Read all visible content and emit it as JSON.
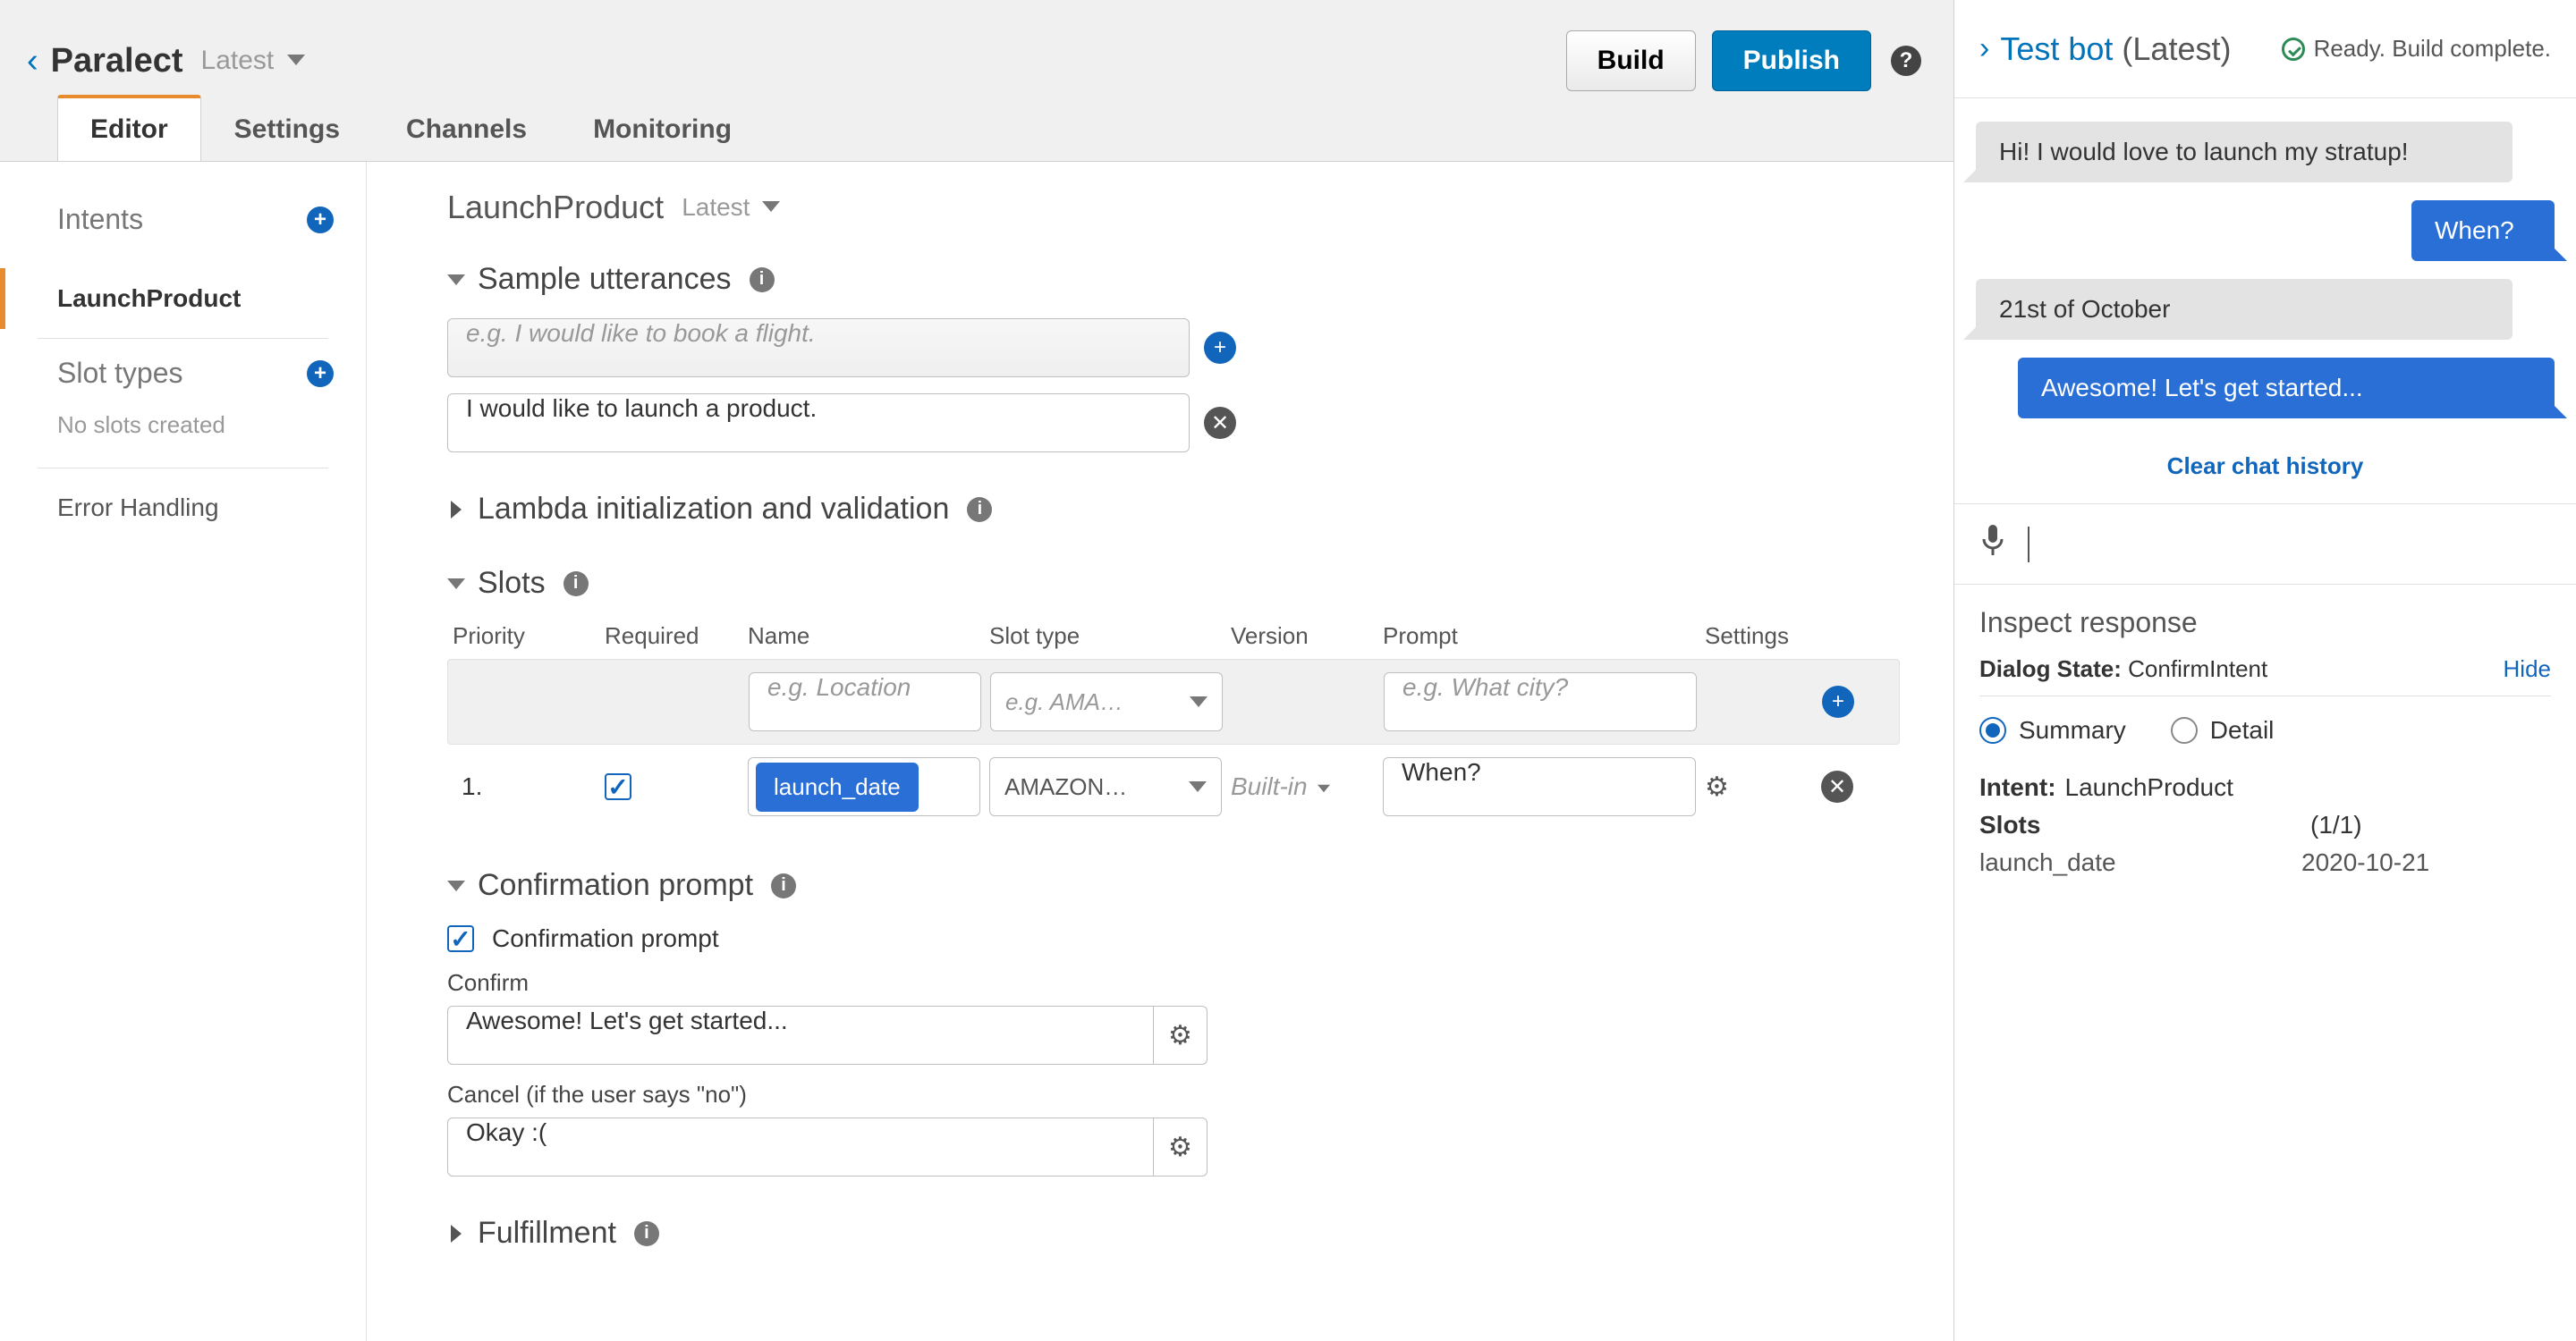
{
  "header": {
    "back_glyph": "‹",
    "title": "Paralect",
    "version": "Latest",
    "build_label": "Build",
    "publish_label": "Publish",
    "help_glyph": "?"
  },
  "tabs": [
    {
      "label": "Editor",
      "active": true
    },
    {
      "label": "Settings",
      "active": false
    },
    {
      "label": "Channels",
      "active": false
    },
    {
      "label": "Monitoring",
      "active": false
    }
  ],
  "sidebar": {
    "intents_label": "Intents",
    "intent_items": [
      "LaunchProduct"
    ],
    "slot_types_label": "Slot types",
    "slot_types_empty": "No slots created",
    "error_handling_label": "Error Handling"
  },
  "intent": {
    "name": "LaunchProduct",
    "version": "Latest"
  },
  "sections": {
    "sample_utterances": "Sample utterances",
    "lambda": "Lambda initialization and validation",
    "slots": "Slots",
    "confirmation": "Confirmation prompt",
    "fulfillment": "Fulfillment"
  },
  "utterances": {
    "placeholder": "e.g. I would like to book a flight.",
    "items": [
      "I would like to launch a product."
    ]
  },
  "slots": {
    "headers": {
      "priority": "Priority",
      "required": "Required",
      "name": "Name",
      "slot_type": "Slot type",
      "version": "Version",
      "prompt": "Prompt",
      "settings": "Settings"
    },
    "placeholders": {
      "name": "e.g. Location",
      "slot_type": "e.g. AMA…",
      "prompt": "e.g. What city?"
    },
    "rows": [
      {
        "priority": "1.",
        "required": true,
        "name": "launch_date",
        "slot_type": "AMAZON…",
        "version": "Built-in",
        "prompt": "When?"
      }
    ]
  },
  "confirmation": {
    "checkbox_label": "Confirmation prompt",
    "confirm_label": "Confirm",
    "confirm_value": "Awesome! Let's get started...",
    "cancel_label": "Cancel (if the user says \"no\")",
    "cancel_value": "Okay :("
  },
  "test_panel": {
    "title": "Test bot",
    "version": "(Latest)",
    "status": "Ready. Build complete.",
    "messages": [
      {
        "role": "user",
        "text": "Hi! I would love to launch my stratup!"
      },
      {
        "role": "bot",
        "text": "When?"
      },
      {
        "role": "user",
        "text": "21st of October"
      },
      {
        "role": "bot",
        "text": "Awesome! Let's get started..."
      }
    ],
    "clear_label": "Clear chat history"
  },
  "inspect": {
    "title": "Inspect response",
    "dialog_state_label": "Dialog State:",
    "dialog_state_value": "ConfirmIntent",
    "hide_label": "Hide",
    "summary_label": "Summary",
    "detail_label": "Detail",
    "intent_label": "Intent:",
    "intent_value": "LaunchProduct",
    "slots_label": "Slots",
    "slots_count": "(1/1)",
    "slot_rows": [
      {
        "name": "launch_date",
        "value": "2020-10-21"
      }
    ]
  },
  "glyphs": {
    "plus": "+",
    "x": "✕",
    "gear": "⚙",
    "mic": "🎤",
    "check": "✓"
  }
}
